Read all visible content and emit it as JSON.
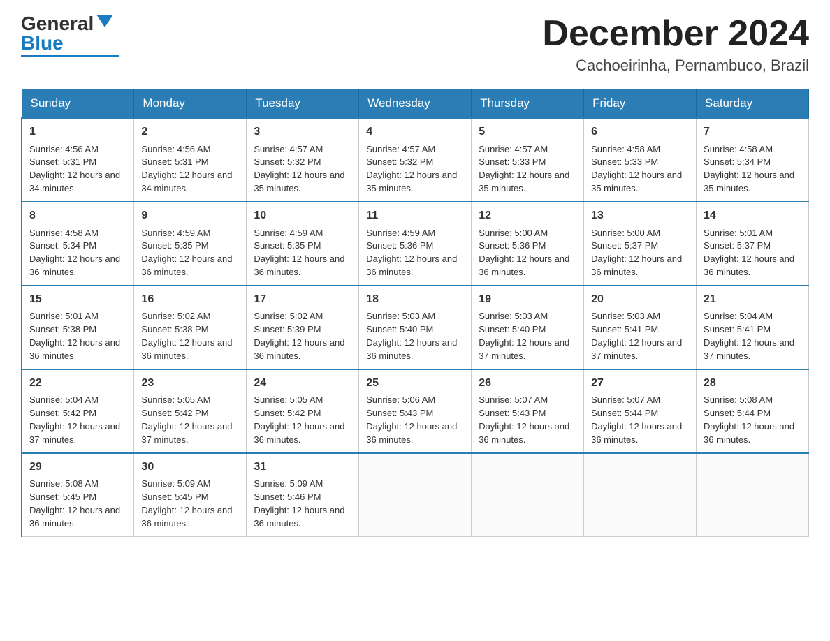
{
  "logo": {
    "general": "General",
    "blue": "Blue"
  },
  "title": "December 2024",
  "subtitle": "Cachoeirinha, Pernambuco, Brazil",
  "headers": [
    "Sunday",
    "Monday",
    "Tuesday",
    "Wednesday",
    "Thursday",
    "Friday",
    "Saturday"
  ],
  "weeks": [
    [
      {
        "day": "1",
        "sunrise": "4:56 AM",
        "sunset": "5:31 PM",
        "daylight": "12 hours and 34 minutes."
      },
      {
        "day": "2",
        "sunrise": "4:56 AM",
        "sunset": "5:31 PM",
        "daylight": "12 hours and 34 minutes."
      },
      {
        "day": "3",
        "sunrise": "4:57 AM",
        "sunset": "5:32 PM",
        "daylight": "12 hours and 35 minutes."
      },
      {
        "day": "4",
        "sunrise": "4:57 AM",
        "sunset": "5:32 PM",
        "daylight": "12 hours and 35 minutes."
      },
      {
        "day": "5",
        "sunrise": "4:57 AM",
        "sunset": "5:33 PM",
        "daylight": "12 hours and 35 minutes."
      },
      {
        "day": "6",
        "sunrise": "4:58 AM",
        "sunset": "5:33 PM",
        "daylight": "12 hours and 35 minutes."
      },
      {
        "day": "7",
        "sunrise": "4:58 AM",
        "sunset": "5:34 PM",
        "daylight": "12 hours and 35 minutes."
      }
    ],
    [
      {
        "day": "8",
        "sunrise": "4:58 AM",
        "sunset": "5:34 PM",
        "daylight": "12 hours and 36 minutes."
      },
      {
        "day": "9",
        "sunrise": "4:59 AM",
        "sunset": "5:35 PM",
        "daylight": "12 hours and 36 minutes."
      },
      {
        "day": "10",
        "sunrise": "4:59 AM",
        "sunset": "5:35 PM",
        "daylight": "12 hours and 36 minutes."
      },
      {
        "day": "11",
        "sunrise": "4:59 AM",
        "sunset": "5:36 PM",
        "daylight": "12 hours and 36 minutes."
      },
      {
        "day": "12",
        "sunrise": "5:00 AM",
        "sunset": "5:36 PM",
        "daylight": "12 hours and 36 minutes."
      },
      {
        "day": "13",
        "sunrise": "5:00 AM",
        "sunset": "5:37 PM",
        "daylight": "12 hours and 36 minutes."
      },
      {
        "day": "14",
        "sunrise": "5:01 AM",
        "sunset": "5:37 PM",
        "daylight": "12 hours and 36 minutes."
      }
    ],
    [
      {
        "day": "15",
        "sunrise": "5:01 AM",
        "sunset": "5:38 PM",
        "daylight": "12 hours and 36 minutes."
      },
      {
        "day": "16",
        "sunrise": "5:02 AM",
        "sunset": "5:38 PM",
        "daylight": "12 hours and 36 minutes."
      },
      {
        "day": "17",
        "sunrise": "5:02 AM",
        "sunset": "5:39 PM",
        "daylight": "12 hours and 36 minutes."
      },
      {
        "day": "18",
        "sunrise": "5:03 AM",
        "sunset": "5:40 PM",
        "daylight": "12 hours and 36 minutes."
      },
      {
        "day": "19",
        "sunrise": "5:03 AM",
        "sunset": "5:40 PM",
        "daylight": "12 hours and 37 minutes."
      },
      {
        "day": "20",
        "sunrise": "5:03 AM",
        "sunset": "5:41 PM",
        "daylight": "12 hours and 37 minutes."
      },
      {
        "day": "21",
        "sunrise": "5:04 AM",
        "sunset": "5:41 PM",
        "daylight": "12 hours and 37 minutes."
      }
    ],
    [
      {
        "day": "22",
        "sunrise": "5:04 AM",
        "sunset": "5:42 PM",
        "daylight": "12 hours and 37 minutes."
      },
      {
        "day": "23",
        "sunrise": "5:05 AM",
        "sunset": "5:42 PM",
        "daylight": "12 hours and 37 minutes."
      },
      {
        "day": "24",
        "sunrise": "5:05 AM",
        "sunset": "5:42 PM",
        "daylight": "12 hours and 36 minutes."
      },
      {
        "day": "25",
        "sunrise": "5:06 AM",
        "sunset": "5:43 PM",
        "daylight": "12 hours and 36 minutes."
      },
      {
        "day": "26",
        "sunrise": "5:07 AM",
        "sunset": "5:43 PM",
        "daylight": "12 hours and 36 minutes."
      },
      {
        "day": "27",
        "sunrise": "5:07 AM",
        "sunset": "5:44 PM",
        "daylight": "12 hours and 36 minutes."
      },
      {
        "day": "28",
        "sunrise": "5:08 AM",
        "sunset": "5:44 PM",
        "daylight": "12 hours and 36 minutes."
      }
    ],
    [
      {
        "day": "29",
        "sunrise": "5:08 AM",
        "sunset": "5:45 PM",
        "daylight": "12 hours and 36 minutes."
      },
      {
        "day": "30",
        "sunrise": "5:09 AM",
        "sunset": "5:45 PM",
        "daylight": "12 hours and 36 minutes."
      },
      {
        "day": "31",
        "sunrise": "5:09 AM",
        "sunset": "5:46 PM",
        "daylight": "12 hours and 36 minutes."
      },
      null,
      null,
      null,
      null
    ]
  ]
}
